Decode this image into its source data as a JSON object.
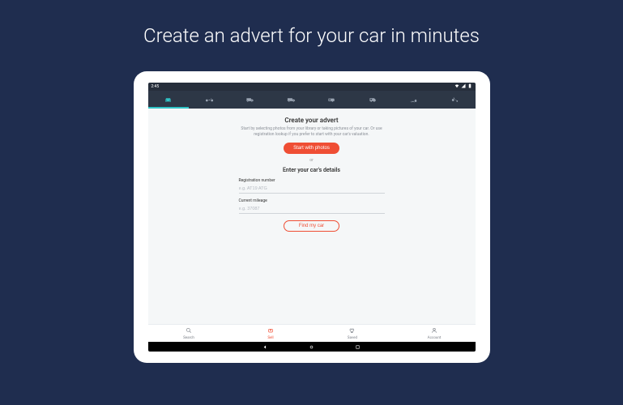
{
  "promo": {
    "title": "Create an advert for your car in minutes"
  },
  "statusbar": {
    "time": "2:45"
  },
  "tabs": [
    {
      "name": "car",
      "active": true
    },
    {
      "name": "motorbike",
      "active": false
    },
    {
      "name": "van",
      "active": false
    },
    {
      "name": "truck",
      "active": false
    },
    {
      "name": "caravan",
      "active": false
    },
    {
      "name": "motorhome",
      "active": false
    },
    {
      "name": "plant",
      "active": false
    },
    {
      "name": "farm",
      "active": false
    }
  ],
  "advert": {
    "title": "Create your advert",
    "subtitle": "Start by selecting photos from your library or taking pictures of your car. Or use registration lookup if you prefer to start with your car's valuation.",
    "primary_cta": "Start with photos",
    "or": "or",
    "details_heading": "Enter your car's details",
    "reg_label": "Registration number",
    "reg_placeholder": "e.g. AT19 ATG",
    "mileage_label": "Current mileage",
    "mileage_placeholder": "e.g. 37087",
    "find_cta": "Find my car"
  },
  "bottomnav": [
    {
      "label": "Search",
      "active": false
    },
    {
      "label": "Sell",
      "active": true
    },
    {
      "label": "Saved",
      "active": false
    },
    {
      "label": "Account",
      "active": false
    }
  ]
}
